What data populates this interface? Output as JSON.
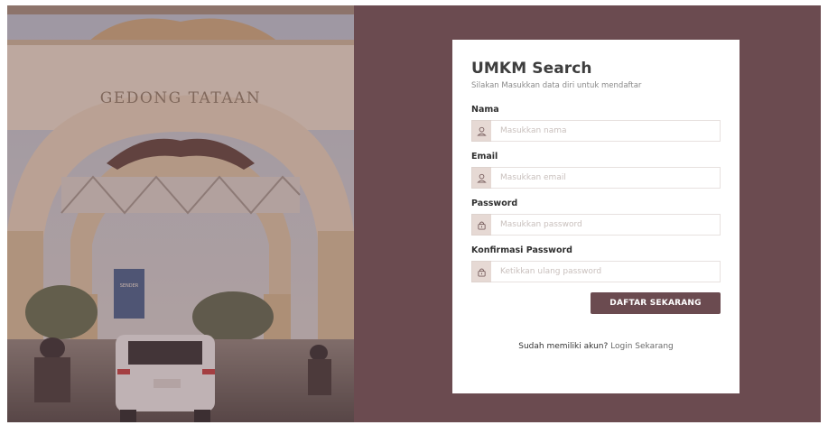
{
  "colors": {
    "background": "#6b4b50",
    "card": "#ffffff",
    "button": "#6b4b50",
    "icon_box": "#e6d9d4"
  },
  "hero": {
    "gate_text": "GEDONG TATAAN",
    "sign_text": "SENDER"
  },
  "card": {
    "title": "UMKM Search",
    "subtitle": "Silakan Masukkan data diri untuk mendaftar"
  },
  "form": {
    "fields": [
      {
        "label": "Nama",
        "placeholder": "Masukkan nama",
        "icon": "user-icon"
      },
      {
        "label": "Email",
        "placeholder": "Masukkan email",
        "icon": "user-icon"
      },
      {
        "label": "Password",
        "placeholder": "Masukkan password",
        "icon": "lock-icon"
      },
      {
        "label": "Konfirmasi Password",
        "placeholder": "Ketikkan ulang password",
        "icon": "lock-icon"
      }
    ],
    "submit_label": "DAFTAR SEKARANG"
  },
  "footer": {
    "question": "Sudah memiliki akun?",
    "link": "Login Sekarang"
  }
}
